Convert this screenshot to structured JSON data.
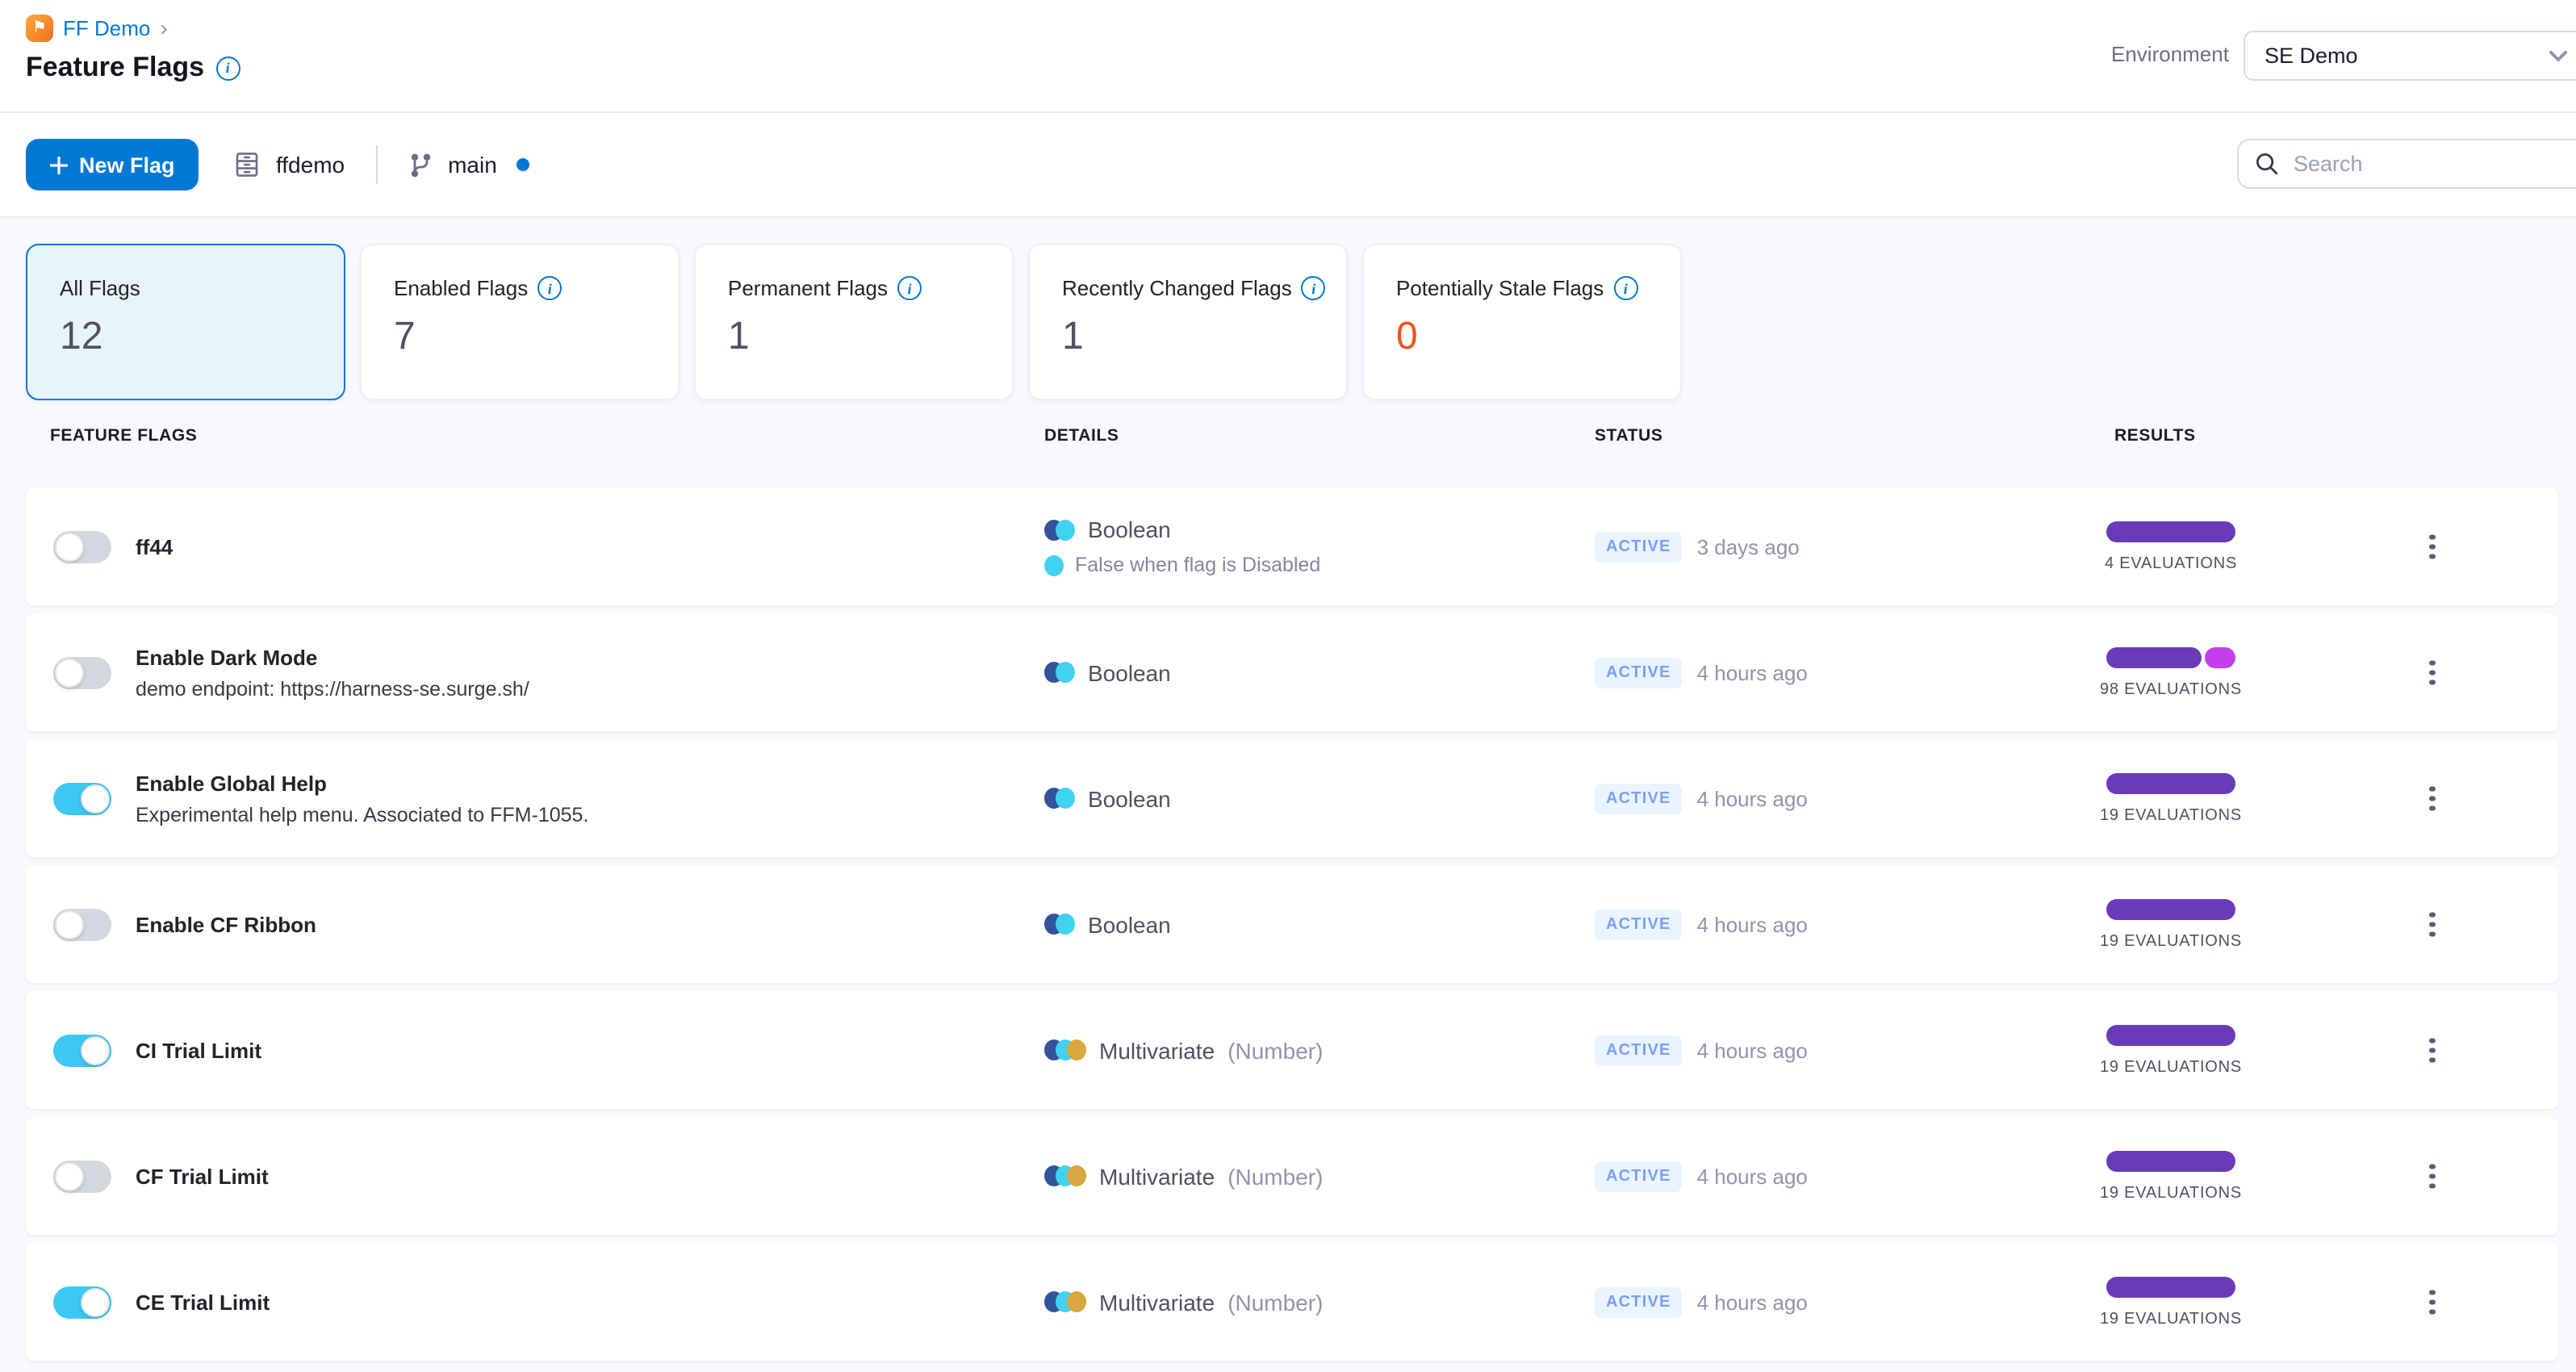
{
  "colors": {
    "accent": "#0278d5",
    "toggle_on": "#3dc7f3",
    "bar_purple": "#693bba",
    "bar_magenta": "#c43eec",
    "stale_orange": "#f4511e",
    "type_navy": "#33539c",
    "type_cyan": "#41d2f2",
    "type_amber": "#d9a63f"
  },
  "breadcrumb": {
    "project": "FF Demo"
  },
  "page_title": "Feature Flags",
  "environment": {
    "label": "Environment",
    "value": "SE Demo"
  },
  "toolbar": {
    "new_flag_label": "New Flag",
    "repo_name": "ffdemo",
    "branch_name": "main",
    "search_placeholder": "Search"
  },
  "summary_cards": [
    {
      "label": "All Flags",
      "value": "12",
      "info": false,
      "selected": true
    },
    {
      "label": "Enabled Flags",
      "value": "7",
      "info": true,
      "selected": false
    },
    {
      "label": "Permanent Flags",
      "value": "1",
      "info": true,
      "selected": false
    },
    {
      "label": "Recently Changed Flags",
      "value": "1",
      "info": true,
      "selected": false
    },
    {
      "label": "Potentially Stale Flags",
      "value": "0",
      "info": true,
      "selected": false,
      "value_color": "#f4511e"
    }
  ],
  "table_headers": {
    "flags": "FEATURE FLAGS",
    "details": "DETAILS",
    "status": "STATUS",
    "results": "RESULTS"
  },
  "rows": [
    {
      "name": "ff44",
      "description": "",
      "enabled": false,
      "type": "Boolean",
      "type_variant": "",
      "type_colors": [
        "#33539c",
        "#41d2f2"
      ],
      "subtext": "False when flag is Disabled",
      "subtext_dot_color": "#41d2f2",
      "status": "ACTIVE",
      "updated": "3 days ago",
      "evaluations": "4 EVALUATIONS",
      "bar": [
        {
          "color": "#693bba",
          "pct": 100
        }
      ]
    },
    {
      "name": "Enable Dark Mode",
      "description": "demo endpoint: https://harness-se.surge.sh/",
      "enabled": false,
      "type": "Boolean",
      "type_variant": "",
      "type_colors": [
        "#33539c",
        "#41d2f2"
      ],
      "subtext": "",
      "subtext_dot_color": "",
      "status": "ACTIVE",
      "updated": "4 hours ago",
      "evaluations": "98 EVALUATIONS",
      "bar": [
        {
          "color": "#693bba",
          "pct": 76
        },
        {
          "color": "#c43eec",
          "pct": 24
        }
      ]
    },
    {
      "name": "Enable Global Help",
      "description": "Experimental help menu. Associated to FFM-1055.",
      "enabled": true,
      "type": "Boolean",
      "type_variant": "",
      "type_colors": [
        "#33539c",
        "#41d2f2"
      ],
      "subtext": "",
      "subtext_dot_color": "",
      "status": "ACTIVE",
      "updated": "4 hours ago",
      "evaluations": "19 EVALUATIONS",
      "bar": [
        {
          "color": "#693bba",
          "pct": 100
        }
      ]
    },
    {
      "name": "Enable CF Ribbon",
      "description": "",
      "enabled": false,
      "type": "Boolean",
      "type_variant": "",
      "type_colors": [
        "#33539c",
        "#41d2f2"
      ],
      "subtext": "",
      "subtext_dot_color": "",
      "status": "ACTIVE",
      "updated": "4 hours ago",
      "evaluations": "19 EVALUATIONS",
      "bar": [
        {
          "color": "#693bba",
          "pct": 100
        }
      ]
    },
    {
      "name": "CI Trial Limit",
      "description": "",
      "enabled": true,
      "type": "Multivariate",
      "type_variant": "(Number)",
      "type_colors": [
        "#33539c",
        "#41d2f2",
        "#d9a63f"
      ],
      "subtext": "",
      "subtext_dot_color": "",
      "status": "ACTIVE",
      "updated": "4 hours ago",
      "evaluations": "19 EVALUATIONS",
      "bar": [
        {
          "color": "#693bba",
          "pct": 100
        }
      ]
    },
    {
      "name": "CF Trial Limit",
      "description": "",
      "enabled": false,
      "type": "Multivariate",
      "type_variant": "(Number)",
      "type_colors": [
        "#33539c",
        "#41d2f2",
        "#d9a63f"
      ],
      "subtext": "",
      "subtext_dot_color": "",
      "status": "ACTIVE",
      "updated": "4 hours ago",
      "evaluations": "19 EVALUATIONS",
      "bar": [
        {
          "color": "#693bba",
          "pct": 100
        }
      ]
    },
    {
      "name": "CE Trial Limit",
      "description": "",
      "enabled": true,
      "type": "Multivariate",
      "type_variant": "(Number)",
      "type_colors": [
        "#33539c",
        "#41d2f2",
        "#d9a63f"
      ],
      "subtext": "",
      "subtext_dot_color": "",
      "status": "ACTIVE",
      "updated": "4 hours ago",
      "evaluations": "19 EVALUATIONS",
      "bar": [
        {
          "color": "#693bba",
          "pct": 100
        }
      ]
    }
  ]
}
